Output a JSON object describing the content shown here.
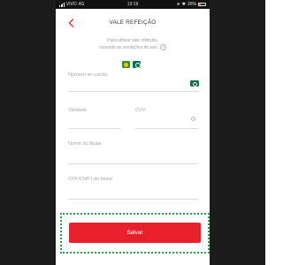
{
  "status_bar": {
    "carrier": "VIVO",
    "network": "4G",
    "time": "13:19",
    "battery": "26%"
  },
  "header": {
    "title": "VALE REFEIÇÃO"
  },
  "info": {
    "line1": "Para utilizar vale refeição,",
    "line2": "consulte as condições de uso.",
    "help_symbol": "?"
  },
  "logos": [
    "vr-logo",
    "alelo-logo"
  ],
  "form": {
    "card_number": {
      "placeholder": "Número do cartão",
      "value": ""
    },
    "validity": {
      "placeholder": "Validade",
      "value": ""
    },
    "cvv": {
      "placeholder": "CVV",
      "value": "",
      "info_symbol": "i"
    },
    "holder_name": {
      "placeholder": "Nome do titular",
      "value": ""
    },
    "holder_cpf": {
      "placeholder": "CPF/CNPJ do titular",
      "value": ""
    }
  },
  "actions": {
    "save_label": "Salvar"
  },
  "colors": {
    "accent": "#e8202a",
    "highlight": "#21a34b",
    "frame": "#1c1c1c"
  }
}
